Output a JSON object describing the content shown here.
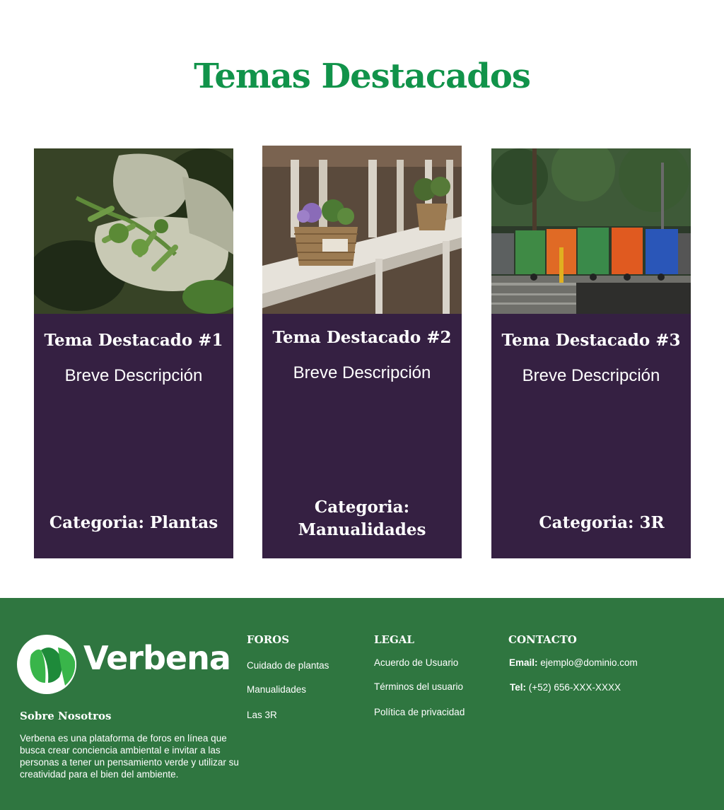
{
  "heading": "Temas Destacados",
  "cards": [
    {
      "title": "Tema Destacado #1",
      "description": "Breve Descripción",
      "category": "Categoria: Plantas",
      "image": "gardening-gloves-photo"
    },
    {
      "title": "Tema Destacado #2",
      "description": "Breve Descripción",
      "category": "Categoria: Manualidades",
      "image": "wicker-basket-plants-photo"
    },
    {
      "title": "Tema Destacado #3",
      "description": "Breve Descripción",
      "category": "Categoria: 3R",
      "image": "recycling-bins-photo"
    }
  ],
  "footer": {
    "logo_text": "Verbena",
    "about_title": "Sobre Nosotros",
    "about_text": "Verbena es una plataforma de foros en línea que busca crear conciencia ambiental e invitar a las personas a tener un pensamiento verde y utilizar su creatividad para el bien del ambiente.",
    "foros": {
      "title": "FOROS",
      "links": [
        "Cuidado de plantas",
        "Manualidades",
        "Las 3R"
      ]
    },
    "legal": {
      "title": "LEGAL",
      "links": [
        "Acuerdo de Usuario",
        "Términos del usuario",
        "Política de privacidad"
      ]
    },
    "contacto": {
      "title": "CONTACTO",
      "email_label": "Email:",
      "email": "ejemplo@dominio.com",
      "tel_label": "Tel:",
      "tel": "(+52) 656-XXX-XXXX"
    }
  },
  "colors": {
    "heading": "#11934a",
    "card": "#352042",
    "footer": "#2f7640"
  }
}
